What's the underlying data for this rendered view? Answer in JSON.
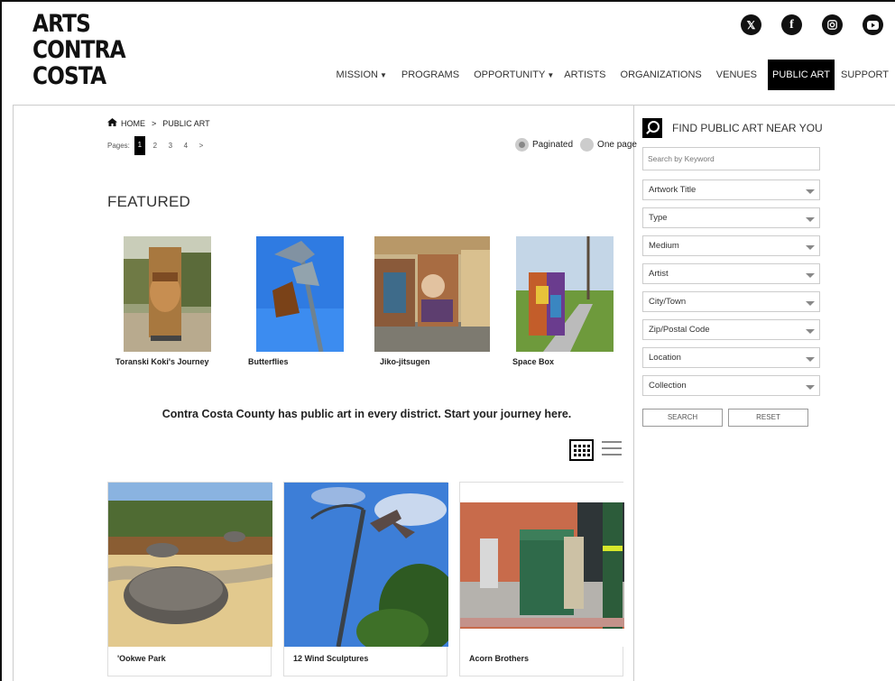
{
  "logo": {
    "lines": [
      "ARTS",
      "CONTRA",
      "COSTA"
    ]
  },
  "social": [
    "x-icon",
    "facebook-icon",
    "instagram-icon",
    "youtube-icon"
  ],
  "nav": {
    "items": [
      "MISSION",
      "PROGRAMS",
      "OPPORTUNITY",
      "ARTISTS",
      "ORGANIZATIONS",
      "VENUES",
      "PUBLIC ART",
      "SUPPORT"
    ],
    "active": "PUBLIC ART"
  },
  "breadcrumb": {
    "home": "HOME",
    "sep": ">",
    "current": "PUBLIC ART"
  },
  "pagination": {
    "label": "Pages:",
    "pages": [
      "1",
      "2",
      "3",
      "4",
      ">"
    ],
    "current": "1"
  },
  "view_options": {
    "paginated": "Paginated",
    "one_page": "One page",
    "selected": "Paginated"
  },
  "featured": {
    "heading": "FEATURED",
    "items": [
      "Toranski Koki's Journey",
      "Butterflies",
      "Jiko-jitsugen",
      "Space Box"
    ]
  },
  "tagline": "Contra Costa County has public art in every district. Start your journey here.",
  "cards": [
    "'Ookwe Park",
    "12 Wind Sculptures",
    "Acorn Brothers"
  ],
  "sidebar": {
    "title": "FIND PUBLIC ART NEAR YOU",
    "keyword_placeholder": "Search by Keyword",
    "filters": [
      "Artwork Title",
      "Type",
      "Medium",
      "Artist",
      "City/Town",
      "Zip/Postal Code",
      "Location",
      "Collection"
    ],
    "search": "SEARCH",
    "reset": "RESET"
  }
}
